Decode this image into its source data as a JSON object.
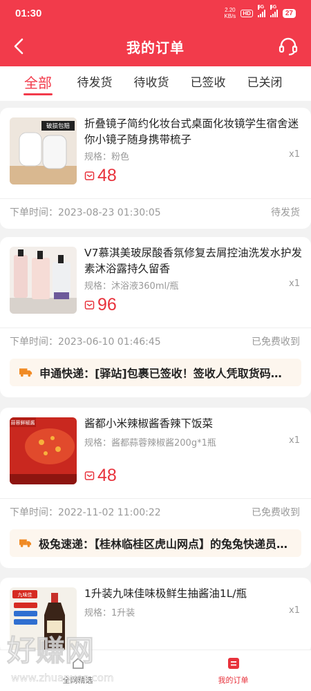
{
  "status_bar": {
    "time": "01:30",
    "net_speed": "2.20",
    "net_unit": "KB/s",
    "hd": "HD",
    "sig1": "5G",
    "sig2": "5G",
    "battery": "27"
  },
  "header": {
    "title": "我的订单"
  },
  "tabs": [
    {
      "label": "全部"
    },
    {
      "label": "待发货"
    },
    {
      "label": "待收货"
    },
    {
      "label": "已签收"
    },
    {
      "label": "已关闭"
    }
  ],
  "orders": [
    {
      "name": "折叠镜子简约化妆台式桌面化妆镜学生宿舍迷你小镜子随身携带梳子",
      "thumb_badge": "破损包赔",
      "spec": "规格：粉色",
      "qty": "x1",
      "price": "48",
      "order_time": "下单时间：2023-08-23 01:30:05",
      "status": "待发货"
    },
    {
      "name": "V7慕淇美玻尿酸香氛修复去屑控油洗发水护发素沐浴露持久留香",
      "spec": "规格：沐浴液360ml/瓶",
      "qty": "x1",
      "price": "96",
      "order_time": "下单时间：2023-06-10 01:46:45",
      "status": "已免费收到",
      "tracking": "申通快递：[驿站]包裹已签收！签收人凭取货码签收。"
    },
    {
      "name": "酱都小米辣椒酱香辣下饭菜",
      "thumb_badge": "蒜蓉鲜椒酱",
      "spec": "规格：酱都蒜蓉辣椒酱200g*1瓶",
      "qty": "x1",
      "price": "48",
      "order_time": "下单时间：2022-11-02 11:00:22",
      "status": "已免费收到",
      "tracking": "极兔速递：【桂林临桂区虎山网点】的兔兔快递员正在派件"
    },
    {
      "name": "1升装九味佳味极鲜生抽酱油1L/瓶",
      "thumb_badge": "九味佳",
      "spec": "规格：1升装",
      "qty": "x1"
    }
  ],
  "bottom_nav": [
    {
      "label": "全网精选"
    },
    {
      "label": "我的订单"
    }
  ],
  "watermark": {
    "title": "好赚网",
    "url": "www.zhuanyes.com"
  },
  "colors": {
    "brand_red": "#f23b4b",
    "price_red": "#e8323c",
    "tracking_bg": "#fdf6ee",
    "truck_orange": "#f08a24"
  }
}
